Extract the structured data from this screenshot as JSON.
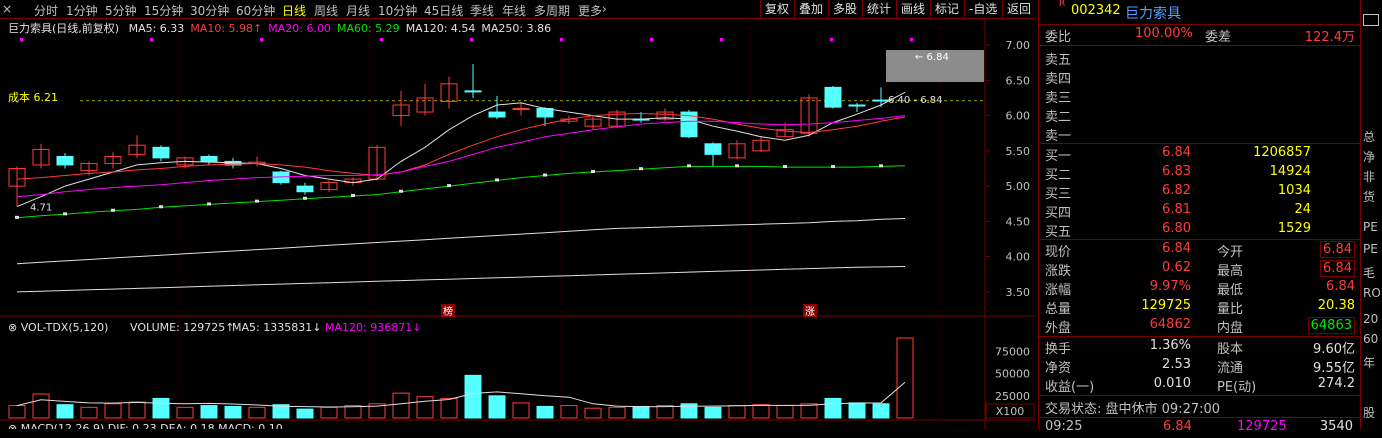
{
  "toolbar": {
    "periods": [
      "分时",
      "1分钟",
      "5分钟",
      "15分钟",
      "30分钟",
      "60分钟",
      "日线",
      "周线",
      "月线",
      "10分钟",
      "45日线",
      "季线",
      "年线",
      "多周期",
      "更多"
    ],
    "active_period": "日线",
    "more_arrow": "›",
    "tools": [
      "复权",
      "叠加",
      "多股",
      "统计",
      "画线",
      "标记",
      "-自选",
      "返回"
    ],
    "close_glyph": "×"
  },
  "chart": {
    "title": "巨力索具(日线,前复权)",
    "ma": [
      {
        "label": "MA5: 6.33",
        "color": "#e0e0e0"
      },
      {
        "label": "MA10: 5.98",
        "color": "#ff3c3c"
      },
      {
        "label": "MA20: 6.00",
        "color": "#ff00ff"
      },
      {
        "label": "MA60: 5.29",
        "color": "#00e600"
      },
      {
        "label": "MA120: 4.54",
        "color": "#e0e0e0"
      },
      {
        "label": "MA250: 3.86",
        "color": "#e0e0e0"
      }
    ],
    "cost_label": "成本 6.21",
    "low_marker": "4.71",
    "range_marker": "6.40 - 6.84",
    "price_tag": "6.84",
    "y_ticks": [
      "7.00",
      "6.50",
      "6.00",
      "5.50",
      "5.00",
      "4.50",
      "4.00",
      "3.50"
    ],
    "badges": [
      "榜",
      "涨"
    ]
  },
  "volume": {
    "title": "VOL-TDX(5,120)",
    "volume": "VOLUME: 129725",
    "ma5": "MA5: 1335831",
    "ma120": "MA120: 936871",
    "y_ticks": [
      "75000",
      "50000",
      "25000"
    ],
    "multiplier": "X100"
  },
  "macd": {
    "label": "MACD(12,26,9)  DIF: 0.23  DEA: 0.18  MACD: 0.10"
  },
  "chart_data": {
    "type": "candlestick",
    "ylim": [
      3.3,
      7.1
    ],
    "candles": [
      {
        "o": 5.0,
        "c": 5.25,
        "h": 5.28,
        "l": 4.71,
        "up": true
      },
      {
        "o": 5.3,
        "c": 5.52,
        "h": 5.6,
        "l": 5.25,
        "up": true
      },
      {
        "o": 5.42,
        "c": 5.3,
        "h": 5.47,
        "l": 5.25,
        "up": false
      },
      {
        "o": 5.22,
        "c": 5.32,
        "h": 5.35,
        "l": 5.15,
        "up": true
      },
      {
        "o": 5.32,
        "c": 5.42,
        "h": 5.48,
        "l": 5.25,
        "up": true
      },
      {
        "o": 5.45,
        "c": 5.58,
        "h": 5.72,
        "l": 5.4,
        "up": true
      },
      {
        "o": 5.55,
        "c": 5.4,
        "h": 5.58,
        "l": 5.35,
        "up": false
      },
      {
        "o": 5.3,
        "c": 5.4,
        "h": 5.42,
        "l": 5.25,
        "up": true
      },
      {
        "o": 5.42,
        "c": 5.35,
        "h": 5.45,
        "l": 5.3,
        "up": false
      },
      {
        "o": 5.35,
        "c": 5.3,
        "h": 5.4,
        "l": 5.25,
        "up": false
      },
      {
        "o": 5.32,
        "c": 5.34,
        "h": 5.42,
        "l": 5.28,
        "up": true
      },
      {
        "o": 5.2,
        "c": 5.05,
        "h": 5.22,
        "l": 5.02,
        "up": false
      },
      {
        "o": 5.0,
        "c": 4.92,
        "h": 5.05,
        "l": 4.88,
        "up": false
      },
      {
        "o": 4.95,
        "c": 5.05,
        "h": 5.08,
        "l": 4.92,
        "up": true
      },
      {
        "o": 5.05,
        "c": 5.1,
        "h": 5.12,
        "l": 5.0,
        "up": true
      },
      {
        "o": 5.1,
        "c": 5.55,
        "h": 5.58,
        "l": 5.08,
        "up": true
      },
      {
        "o": 6.0,
        "c": 6.15,
        "h": 6.35,
        "l": 5.85,
        "up": true
      },
      {
        "o": 6.05,
        "c": 6.25,
        "h": 6.45,
        "l": 6.0,
        "up": true
      },
      {
        "o": 6.2,
        "c": 6.45,
        "h": 6.55,
        "l": 6.1,
        "up": true
      },
      {
        "o": 6.35,
        "c": 6.35,
        "h": 6.73,
        "l": 6.25,
        "up": false
      },
      {
        "o": 6.05,
        "c": 5.98,
        "h": 6.28,
        "l": 5.95,
        "up": false
      },
      {
        "o": 6.1,
        "c": 6.1,
        "h": 6.18,
        "l": 6.0,
        "up": true
      },
      {
        "o": 6.1,
        "c": 5.98,
        "h": 6.12,
        "l": 5.85,
        "up": false
      },
      {
        "o": 5.92,
        "c": 5.95,
        "h": 6.0,
        "l": 5.88,
        "up": true
      },
      {
        "o": 5.85,
        "c": 5.95,
        "h": 6.0,
        "l": 5.8,
        "up": true
      },
      {
        "o": 5.85,
        "c": 6.05,
        "h": 6.08,
        "l": 5.82,
        "up": true
      },
      {
        "o": 5.95,
        "c": 5.95,
        "h": 6.05,
        "l": 5.9,
        "up": false
      },
      {
        "o": 5.95,
        "c": 6.05,
        "h": 6.1,
        "l": 5.92,
        "up": true
      },
      {
        "o": 6.05,
        "c": 5.7,
        "h": 6.08,
        "l": 5.68,
        "up": false
      },
      {
        "o": 5.6,
        "c": 5.45,
        "h": 5.62,
        "l": 5.28,
        "up": false
      },
      {
        "o": 5.4,
        "c": 5.6,
        "h": 5.65,
        "l": 5.38,
        "up": true
      },
      {
        "o": 5.5,
        "c": 5.65,
        "h": 5.7,
        "l": 5.48,
        "up": true
      },
      {
        "o": 5.7,
        "c": 5.8,
        "h": 5.9,
        "l": 5.7,
        "up": true
      },
      {
        "o": 5.75,
        "c": 6.25,
        "h": 6.3,
        "l": 5.7,
        "up": true
      },
      {
        "o": 6.4,
        "c": 6.12,
        "h": 6.42,
        "l": 6.1,
        "up": false
      },
      {
        "o": 6.15,
        "c": 6.15,
        "h": 6.18,
        "l": 6.05,
        "up": false
      },
      {
        "o": 6.22,
        "c": 6.22,
        "h": 6.4,
        "l": 6.12,
        "up": false
      },
      {
        "o": 6.84,
        "c": 6.84,
        "h": 6.84,
        "l": 6.84,
        "up": true
      }
    ],
    "ma_lines": {
      "ma5": [
        4.71,
        4.85,
        5.0,
        5.1,
        5.2,
        5.3,
        5.33,
        5.35,
        5.34,
        5.33,
        5.32,
        5.25,
        5.15,
        5.1,
        5.05,
        5.1,
        5.35,
        5.55,
        5.8,
        6.0,
        6.15,
        6.18,
        6.1,
        6.05,
        6.0,
        5.95,
        5.95,
        5.97,
        5.95,
        5.85,
        5.78,
        5.7,
        5.65,
        5.72,
        5.9,
        6.02,
        6.15,
        6.33
      ],
      "ma10": [
        5.1,
        5.12,
        5.15,
        5.18,
        5.2,
        5.23,
        5.25,
        5.28,
        5.3,
        5.31,
        5.32,
        5.3,
        5.27,
        5.22,
        5.18,
        5.15,
        5.2,
        5.3,
        5.45,
        5.58,
        5.7,
        5.8,
        5.88,
        5.95,
        6.0,
        6.02,
        6.03,
        6.02,
        6.0,
        5.95,
        5.88,
        5.82,
        5.78,
        5.76,
        5.8,
        5.85,
        5.92,
        5.98
      ],
      "ma20": [
        4.85,
        4.88,
        4.92,
        4.95,
        4.98,
        5.0,
        5.02,
        5.05,
        5.08,
        5.1,
        5.12,
        5.13,
        5.14,
        5.15,
        5.15,
        5.16,
        5.2,
        5.28,
        5.35,
        5.45,
        5.55,
        5.62,
        5.7,
        5.75,
        5.8,
        5.84,
        5.88,
        5.9,
        5.92,
        5.92,
        5.9,
        5.88,
        5.87,
        5.88,
        5.9,
        5.93,
        5.96,
        6.0
      ],
      "ma60": [
        4.55,
        4.58,
        4.6,
        4.63,
        4.65,
        4.67,
        4.7,
        4.72,
        4.74,
        4.76,
        4.78,
        4.8,
        4.82,
        4.84,
        4.86,
        4.88,
        4.92,
        4.96,
        5.0,
        5.04,
        5.08,
        5.12,
        5.15,
        5.18,
        5.2,
        5.22,
        5.24,
        5.26,
        5.28,
        5.28,
        5.28,
        5.28,
        5.27,
        5.27,
        5.27,
        5.27,
        5.28,
        5.29
      ],
      "ma120": [
        3.9,
        3.92,
        3.94,
        3.96,
        3.98,
        4.0,
        4.02,
        4.04,
        4.06,
        4.08,
        4.1,
        4.12,
        4.14,
        4.16,
        4.18,
        4.2,
        4.22,
        4.24,
        4.26,
        4.28,
        4.3,
        4.32,
        4.34,
        4.36,
        4.38,
        4.4,
        4.41,
        4.42,
        4.43,
        4.44,
        4.45,
        4.46,
        4.47,
        4.48,
        4.5,
        4.51,
        4.53,
        4.54
      ],
      "ma250": [
        3.5,
        3.51,
        3.52,
        3.53,
        3.54,
        3.55,
        3.56,
        3.57,
        3.58,
        3.59,
        3.6,
        3.61,
        3.62,
        3.63,
        3.64,
        3.65,
        3.66,
        3.67,
        3.68,
        3.69,
        3.7,
        3.71,
        3.72,
        3.73,
        3.74,
        3.75,
        3.76,
        3.77,
        3.78,
        3.79,
        3.8,
        3.81,
        3.82,
        3.83,
        3.84,
        3.85,
        3.855,
        3.86
      ]
    },
    "volumes": [
      14000,
      27000,
      15000,
      12000,
      16000,
      18000,
      22000,
      12000,
      14000,
      13000,
      12000,
      15000,
      10000,
      12000,
      14000,
      16000,
      28000,
      24000,
      22000,
      48000,
      25000,
      17000,
      13000,
      14000,
      11000,
      12000,
      13000,
      14000,
      16000,
      12000,
      14000,
      15000,
      14000,
      16000,
      22000,
      17000,
      16000,
      129725
    ]
  },
  "quote": {
    "code": "002342",
    "name": "巨力索具",
    "r_badge": "R",
    "webi_label": "委比",
    "webi_value": "100.00%",
    "weicha_label": "委差",
    "weicha_value": "122.4万",
    "sell": [
      {
        "label": "卖五",
        "price": "",
        "vol": ""
      },
      {
        "label": "卖四",
        "price": "",
        "vol": ""
      },
      {
        "label": "卖三",
        "price": "",
        "vol": ""
      },
      {
        "label": "卖二",
        "price": "",
        "vol": ""
      },
      {
        "label": "卖一",
        "price": "",
        "vol": ""
      }
    ],
    "buy": [
      {
        "label": "买一",
        "price": "6.84",
        "vol": "1206857"
      },
      {
        "label": "买二",
        "price": "6.83",
        "vol": "14924"
      },
      {
        "label": "买三",
        "price": "6.82",
        "vol": "1034"
      },
      {
        "label": "买四",
        "price": "6.81",
        "vol": "24"
      },
      {
        "label": "买五",
        "price": "6.80",
        "vol": "1529"
      }
    ],
    "stats": [
      {
        "l1": "现价",
        "v1": "6.84",
        "c1": "red",
        "l2": "今开",
        "v2": "6.84",
        "c2": "red",
        "box": true
      },
      {
        "l1": "涨跌",
        "v1": "0.62",
        "c1": "red",
        "l2": "最高",
        "v2": "6.84",
        "c2": "red",
        "box": true
      },
      {
        "l1": "涨幅",
        "v1": "9.97%",
        "c1": "red",
        "l2": "最低",
        "v2": "6.84",
        "c2": "red",
        "box": false
      },
      {
        "l1": "总量",
        "v1": "129725",
        "c1": "yellow",
        "l2": "量比",
        "v2": "20.38",
        "c2": "yellow",
        "box": false
      },
      {
        "l1": "外盘",
        "v1": "64862",
        "c1": "red",
        "l2": "内盘",
        "v2": "64863",
        "c2": "green",
        "box": true
      }
    ],
    "fin": [
      {
        "l1": "换手",
        "v1": "1.36%",
        "l2": "股本",
        "v2": "9.60亿"
      },
      {
        "l1": "净资",
        "v1": "2.53",
        "l2": "流通",
        "v2": "9.55亿"
      },
      {
        "l1": "收益(一)",
        "v1": "0.010",
        "l2": "PE(动)",
        "v2": "274.2"
      }
    ],
    "status": "交易状态: 盘中休市  09:27:00",
    "tick": {
      "time": "09:25",
      "price": "6.84",
      "vol": "129725",
      "num": "3540"
    }
  },
  "side": {
    "items": [
      "总",
      "净",
      "非",
      "货",
      "PE",
      "PE",
      "毛",
      "RO",
      "20",
      "60",
      "年",
      "股"
    ]
  }
}
